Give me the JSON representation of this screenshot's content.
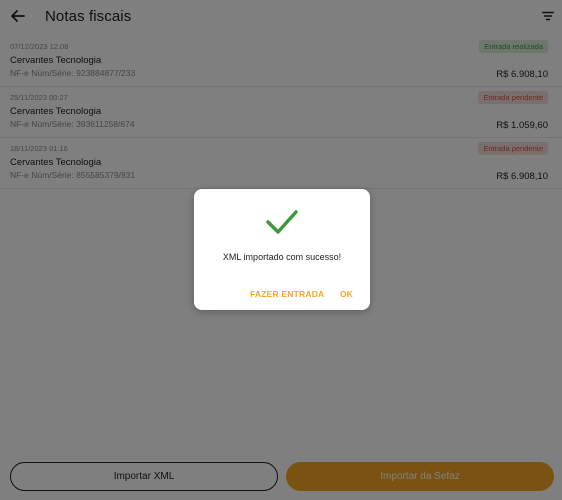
{
  "header": {
    "title": "Notas fiscais",
    "back_icon": "arrow-left-icon",
    "filter_icon": "filter-icon"
  },
  "invoices": [
    {
      "date": "07/12/2023 12:08",
      "company": "Cervantes Tecnologia",
      "nfe": "NF-e Núm/Série: 923884877/233",
      "status": "Entrada realizada",
      "status_type": "done",
      "amount": "R$ 6.908,10"
    },
    {
      "date": "25/11/2023 00:27",
      "company": "Cervantes Tecnologia",
      "nfe": "NF-e Núm/Série: 393611258/674",
      "status": "Entrada pendente",
      "status_type": "pending",
      "amount": "R$ 1.059,60"
    },
    {
      "date": "18/11/2023 01:16",
      "company": "Cervantes Tecnologia",
      "nfe": "NF-e Núm/Série: 855585379/831",
      "status": "Entrada pendente",
      "status_type": "pending",
      "amount": "R$ 6.908,10"
    }
  ],
  "footer": {
    "import_xml_label": "Importar XML",
    "import_sefaz_label": "Importar da Sefaz"
  },
  "dialog": {
    "icon": "check-icon",
    "message": "XML importado com sucesso!",
    "entry_button": "FAZER ENTRADA",
    "ok_button": "OK"
  },
  "colors": {
    "accent": "#f5a523",
    "success": "#3c9a3c",
    "danger": "#d9534f"
  }
}
